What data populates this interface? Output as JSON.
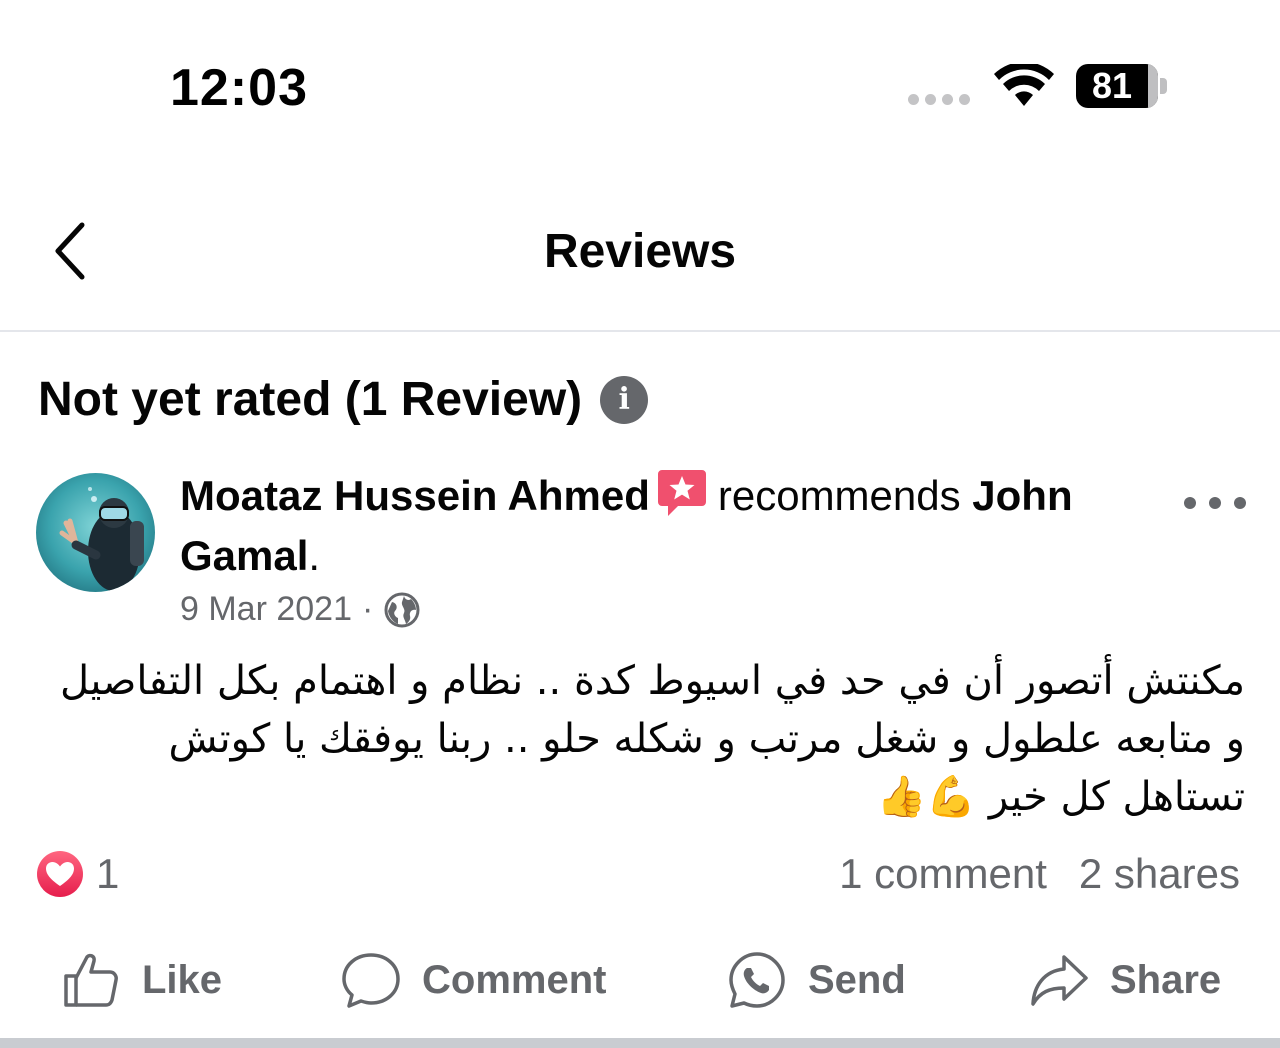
{
  "status_bar": {
    "time": "12:03",
    "battery_level": "81",
    "icons": [
      "cellular-dots-icon",
      "wifi-icon",
      "battery-icon"
    ]
  },
  "header": {
    "title": "Reviews",
    "back_icon": "chevron-left-icon"
  },
  "rating": {
    "summary": "Not yet rated (1 Review)",
    "info_icon": "info-icon",
    "info_glyph": "i"
  },
  "post": {
    "author": "Moataz Hussein Ahmed",
    "badge_icon": "recommendation-star-badge-icon",
    "verb": "recommends",
    "target": "John Gamal",
    "target_suffix": ".",
    "date": "9 Mar 2021",
    "separator": "·",
    "privacy_icon": "globe-icon",
    "body": "مكنتش أتصور أن في حد في اسيوط كدة .. نظام و اهتمام بكل التفاصيل و متابعه علطول و شغل مرتب و شكله حلو .. ربنا يوفقك يا كوتش تستاهل كل خير 💪👍",
    "reaction_icon": "heart-reaction-icon",
    "reaction_count": "1",
    "comments": "1 comment",
    "shares": "2 shares"
  },
  "actions": {
    "like": "Like",
    "comment": "Comment",
    "send": "Send",
    "share": "Share"
  },
  "colors": {
    "text_primary": "#050505",
    "text_secondary": "#65676b",
    "heart_red": "#f33e58",
    "badge_pink": "#f0506e",
    "divider": "#e4e6eb"
  }
}
